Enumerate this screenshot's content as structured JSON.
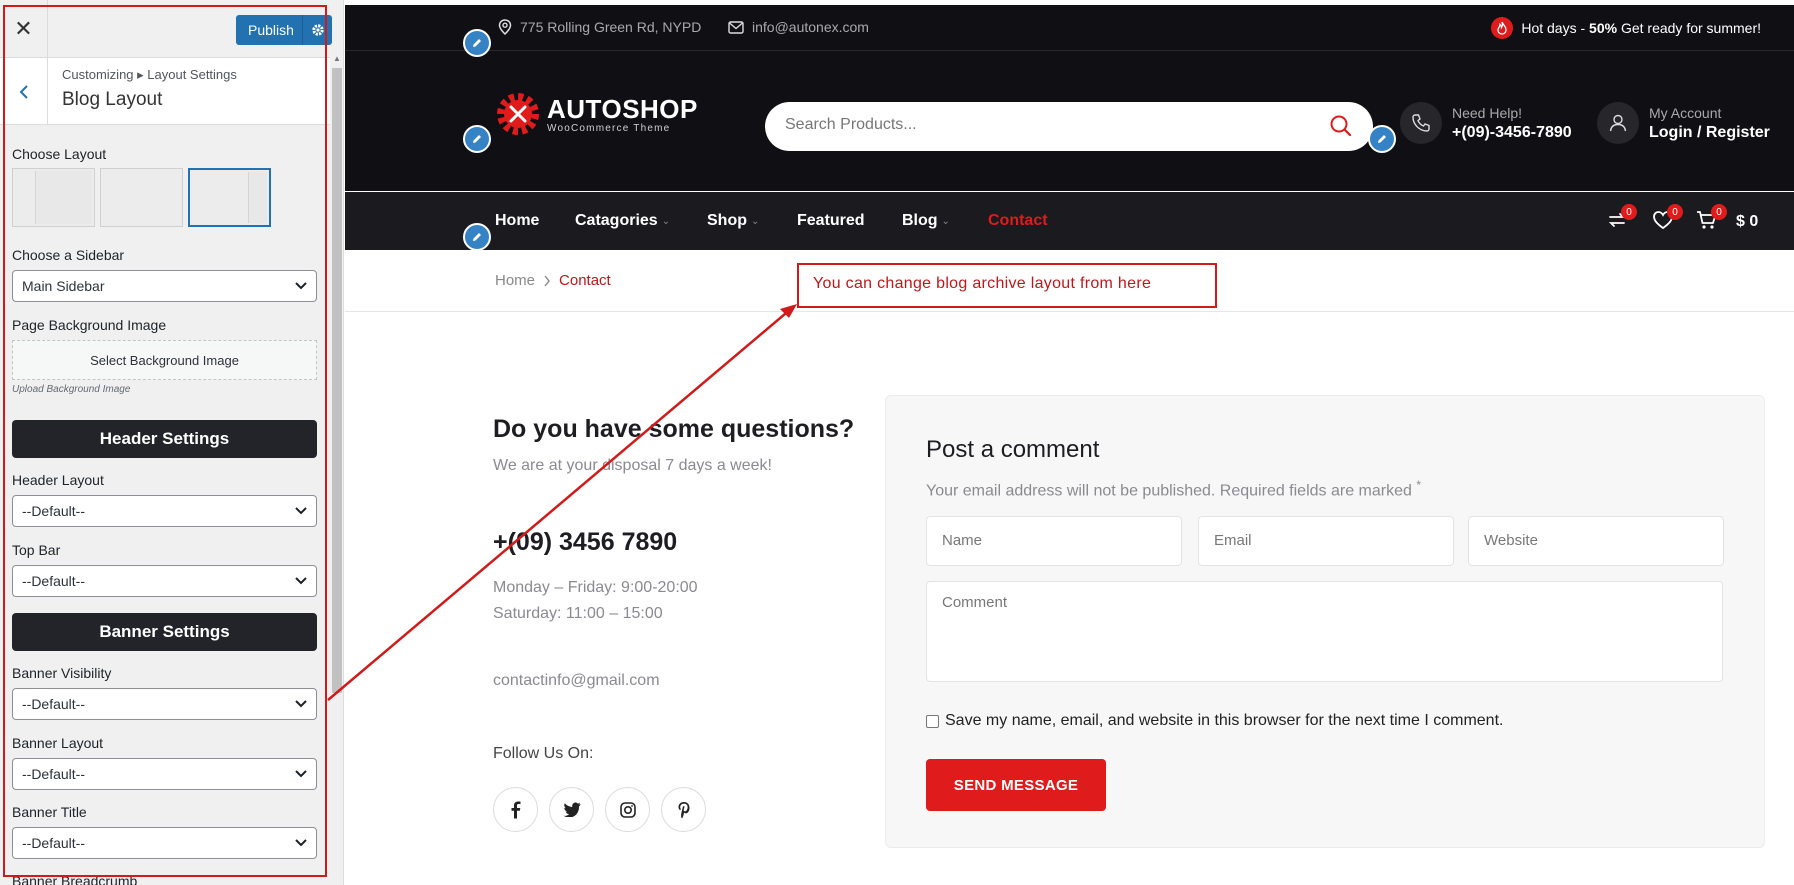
{
  "customizer": {
    "close_icon": "close-icon",
    "publish_label": "Publish",
    "breadcrumb": "Customizing ▸ Layout Settings",
    "title": "Blog Layout",
    "choose_layout": "Choose Layout",
    "choose_sidebar": "Choose a Sidebar",
    "sidebar_value": "Main Sidebar",
    "bg_image_label": "Page Background Image",
    "bg_image_button": "Select Background Image",
    "bg_image_hint": "Upload Background Image",
    "header_section": "Header Settings",
    "header_layout_label": "Header Layout",
    "header_layout_value": "--Default--",
    "top_bar_label": "Top Bar",
    "top_bar_value": "--Default--",
    "banner_section": "Banner Settings",
    "banner_visibility_label": "Banner Visibility",
    "banner_visibility_value": "--Default--",
    "banner_layout_label": "Banner Layout",
    "banner_layout_value": "--Default--",
    "banner_title_label": "Banner Title",
    "banner_title_value": "--Default--",
    "banner_breadcrumb_label": "Banner Breadcrumb"
  },
  "site": {
    "address": "775 Rolling Green Rd, NYPD",
    "email": "info@autonex.com",
    "promo_pre": "Hot days - ",
    "promo_bold": "50%",
    "promo_post": " Get ready for summer!",
    "logo_name": "AUTOSHOP",
    "logo_sub": "WooCommerce Theme",
    "search_placeholder": "Search Products...",
    "help_small": "Need Help!",
    "help_phone": "+(09)-3456-7890",
    "account_small": "My Account",
    "account_big": "Login / Register",
    "nav": [
      "Home",
      "Catagories",
      "Shop",
      "Featured",
      "Blog",
      "Contact"
    ],
    "badges": [
      "0",
      "0",
      "0"
    ],
    "cart_total": "$ 0",
    "breadcrumb_home": "Home",
    "breadcrumb_current": "Contact",
    "annotation": "You can change blog archive layout from  here",
    "contact": {
      "title": "Do you have some questions?",
      "subtitle": "We are at your disposal 7 days a week!",
      "phone": "+(09) 3456 7890",
      "hours1": "Monday – Friday: 9:00-20:00",
      "hours2": "Saturday: 11:00 – 15:00",
      "email": "contactinfo@gmail.com",
      "follow": "Follow Us On:"
    },
    "comment": {
      "title": "Post a comment",
      "note": "Your email address will not be published. Required fields are marked",
      "name_ph": "Name",
      "email_ph": "Email",
      "website_ph": "Website",
      "comment_ph": "Comment",
      "save_label": "Save my name, email, and website in this browser for the next time I comment.",
      "send_label": "SEND MESSAGE"
    }
  },
  "colors": {
    "accent": "#e01b1b",
    "dark": "#101014",
    "wp_blue": "#2271b1"
  }
}
